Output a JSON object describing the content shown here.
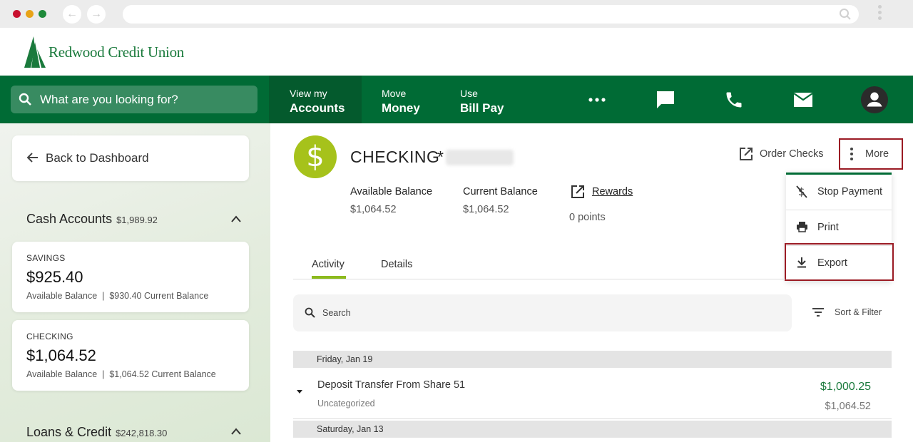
{
  "header": {
    "brand_name": "Redwood Credit Union"
  },
  "topnav": {
    "search_placeholder": "What are you looking for?",
    "tabs": [
      {
        "small": "View my",
        "big": "Accounts"
      },
      {
        "small": "Move",
        "big": "Money"
      },
      {
        "small": "Use",
        "big": "Bill Pay"
      }
    ],
    "colors": {
      "primary": "#006b35",
      "active": "#045a2d",
      "accent": "#a6c21b",
      "highlight_border": "#9b1b24"
    }
  },
  "sidebar": {
    "back_label": "Back to Dashboard",
    "cash_accounts": {
      "title": "Cash Accounts",
      "total": "$1,989.92"
    },
    "accounts": [
      {
        "type": "SAVINGS",
        "amount": "$925.40",
        "available_label": "Available Balance",
        "separator": "|",
        "current": "$930.40 Current Balance"
      },
      {
        "type": "CHECKING",
        "amount": "$1,064.52",
        "available_label": "Available Balance",
        "separator": "|",
        "current": "$1,064.52 Current Balance"
      }
    ],
    "loans": {
      "title": "Loans & Credit",
      "total": "$242,818.30"
    }
  },
  "account": {
    "icon_glyph": "$",
    "name": "CHECKING",
    "mask_prefix": "*",
    "available_label": "Available Balance",
    "available_value": "$1,064.52",
    "current_label": "Current Balance",
    "current_value": "$1,064.52",
    "rewards_label": "Rewards",
    "points": "0 points",
    "order_checks_label": "Order Checks",
    "more_label": "More"
  },
  "more_menu": {
    "items": [
      "Stop Payment",
      "Print",
      "Export"
    ]
  },
  "tabs": [
    "Activity",
    "Details"
  ],
  "activity": {
    "search_placeholder": "Search",
    "sort_label": "Sort & Filter",
    "groups": [
      {
        "date": "Friday, Jan 19"
      },
      {
        "date": "Saturday, Jan 13"
      }
    ],
    "transactions": [
      {
        "description": "Deposit Transfer From Share 51",
        "category": "Uncategorized",
        "amount": "$1,000.25",
        "balance": "$1,064.52"
      }
    ]
  }
}
